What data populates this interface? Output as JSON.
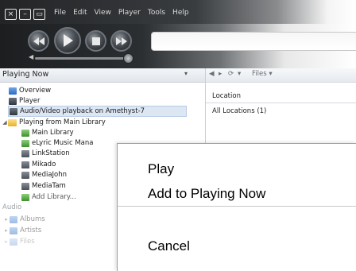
{
  "window": {
    "buttons": [
      "×",
      "–",
      "▭"
    ]
  },
  "menu": [
    "File",
    "Edit",
    "View",
    "Player",
    "Tools",
    "Help"
  ],
  "left_pane": {
    "header": "Playing Now",
    "items": [
      {
        "label": "Overview",
        "icon": "overview-icon"
      },
      {
        "label": "Player",
        "icon": "player-icon"
      },
      {
        "label": "Audio/Video playback on Amethyst-7",
        "icon": "zone-icon",
        "selected": true
      },
      {
        "label": "Playing from Main Library",
        "icon": "folder-icon"
      },
      {
        "label": "Main Library",
        "icon": "library-icon"
      },
      {
        "label": "eLyric Music Mana",
        "icon": "library-icon"
      },
      {
        "label": "LinkStation",
        "icon": "network-library-icon"
      },
      {
        "label": "Mikado",
        "icon": "network-library-icon"
      },
      {
        "label": "MediaJohn",
        "icon": "network-library-icon"
      },
      {
        "label": "MediaTam",
        "icon": "network-library-icon"
      },
      {
        "label": "Add Library...",
        "icon": "add-library-icon"
      }
    ],
    "section_audio": "Audio",
    "audio_items": [
      "Albums",
      "Artists",
      "Files"
    ]
  },
  "right_pane": {
    "toolbar_files": "Files",
    "column_header": "Location",
    "row": "All Locations (1)"
  },
  "context_menu": {
    "items": [
      "Play",
      "Add to Playing Now",
      "Cancel"
    ]
  }
}
